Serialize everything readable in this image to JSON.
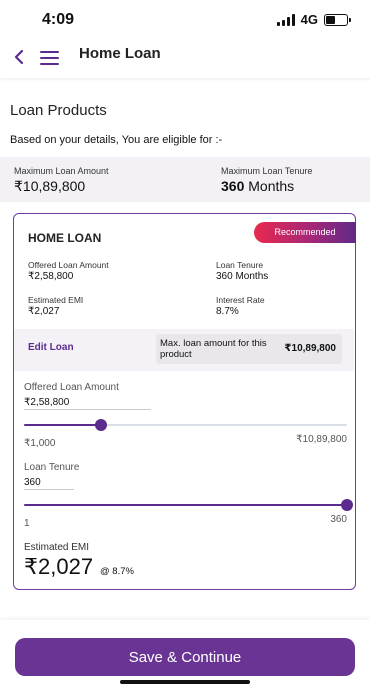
{
  "status_bar": {
    "time": "4:09",
    "network": "4G"
  },
  "header": {
    "title": "Home Loan"
  },
  "section": {
    "title": "Loan Products",
    "eligible_text": "Based on your details, You are eligible for :-"
  },
  "summary": {
    "max_amount_label": "Maximum Loan Amount",
    "max_amount_value": "₹10,89,800",
    "max_tenure_label": "Maximum Loan Tenure",
    "max_tenure_number": "360",
    "max_tenure_unit": "Months"
  },
  "card": {
    "title": "HOME LOAN",
    "badge": "Recommended",
    "offered_amount_label": "Offered Loan Amount",
    "offered_amount_value": "₹2,58,800",
    "loan_tenure_label": "Loan Tenure",
    "loan_tenure_value": "360 Months",
    "emi_label": "Estimated EMI",
    "emi_value": "₹2,027",
    "interest_label": "Interest Rate",
    "interest_value": "8.7%",
    "edit_link": "Edit Loan",
    "max_product_label": "Max. loan amount for this product",
    "max_product_value": "₹10,89,800"
  },
  "amount_slider": {
    "label": "Offered Loan Amount",
    "input_value": "₹2,58,800",
    "min_label": "₹1,000",
    "max_label": "₹10,89,800",
    "fraction": 0.237
  },
  "tenure_slider": {
    "label": "Loan Tenure",
    "input_value": "360",
    "min_label": "1",
    "max_label": "360",
    "fraction": 1.0
  },
  "emi_summary": {
    "label": "Estimated EMI",
    "value": "₹2,027",
    "rate": "@ 8.7%"
  },
  "footer": {
    "save_label": "Save & Continue"
  },
  "colors": {
    "brand_purple": "#5b2c8d",
    "button_purple": "#6a3494",
    "badge_start": "#e8294f"
  }
}
